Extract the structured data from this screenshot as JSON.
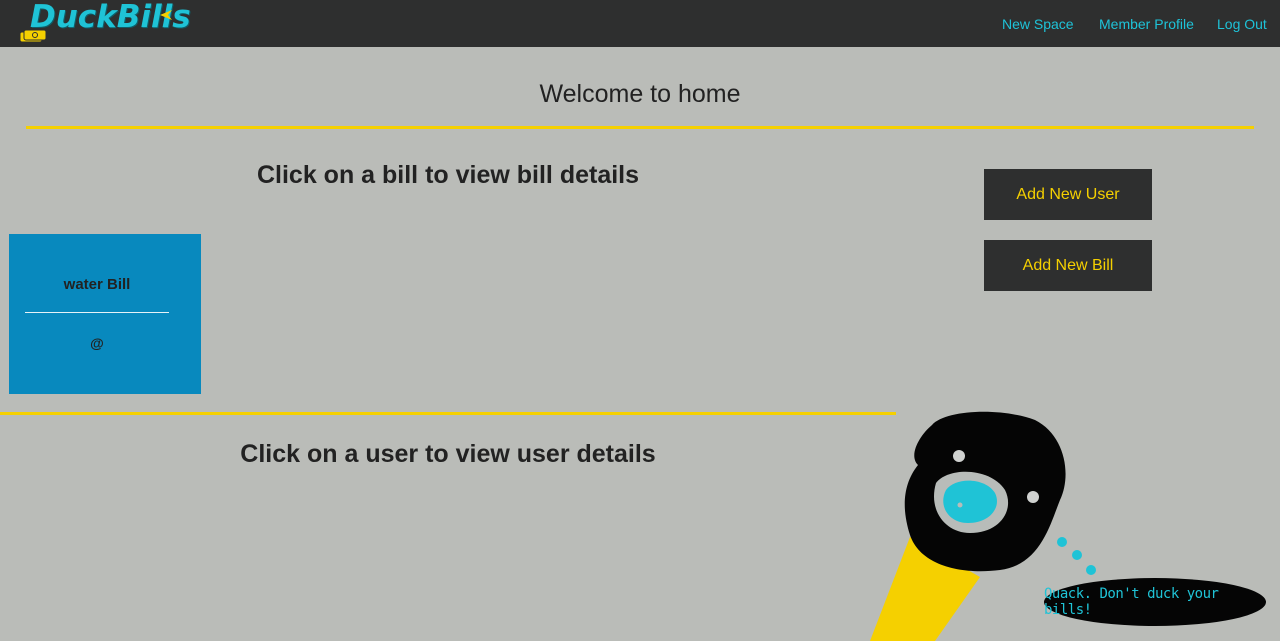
{
  "brand": {
    "name": "DuckBills",
    "colors": {
      "accent": "#1fc3d6",
      "highlight": "#f5d000",
      "nav_bg": "#2e2f2f",
      "page_bg": "#babcb8",
      "card_bg": "#0889be"
    }
  },
  "nav": {
    "links": [
      {
        "label": "New Space"
      },
      {
        "label": "Member Profile"
      },
      {
        "label": "Log Out"
      }
    ]
  },
  "main": {
    "welcome": "Welcome to home",
    "bills_heading": "Click on a bill to view bill details",
    "users_heading": "Click on a user to view user details",
    "bills": [
      {
        "name": "water Bill",
        "meta": "@"
      }
    ],
    "actions": {
      "add_user": "Add New User",
      "add_bill": "Add New Bill"
    }
  },
  "mascot": {
    "speech": "Quack. Don't duck your bills!",
    "icon": "duck-head-icon"
  }
}
